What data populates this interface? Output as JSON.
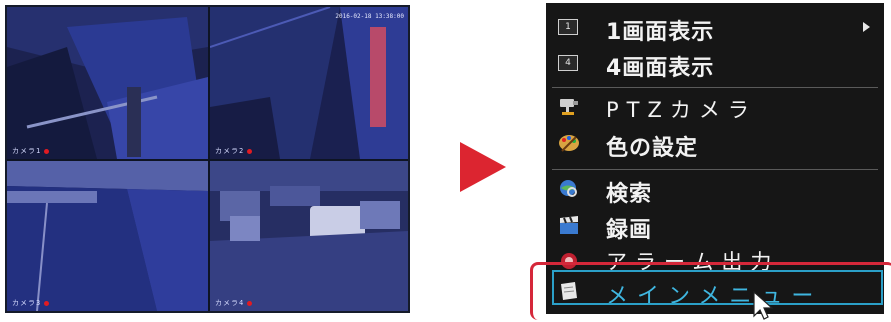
{
  "camera_view": {
    "timestamp": "2016-02-18 13:38:00",
    "tiles": [
      {
        "label": "カメラ1"
      },
      {
        "label": "カメラ2"
      },
      {
        "label": "カメラ3"
      },
      {
        "label": "カメラ4"
      }
    ]
  },
  "menu": {
    "items": [
      {
        "icon": "box-1-icon",
        "box_text": "1",
        "label": "1画面表示",
        "submenu": true
      },
      {
        "icon": "box-4-icon",
        "box_text": "4",
        "label": "4画面表示"
      },
      {
        "icon": "ptz-camera-icon",
        "label": "PTZカメラ"
      },
      {
        "icon": "palette-icon",
        "label": "色の設定"
      },
      {
        "icon": "search-globe-icon",
        "label": "検索"
      },
      {
        "icon": "clapperboard-icon",
        "label": "録画"
      },
      {
        "icon": "alarm-icon",
        "label": "アラーム出力"
      },
      {
        "icon": "document-icon",
        "label": "メインメニュー",
        "highlighted": true
      }
    ]
  },
  "colors": {
    "menu_background": "#161616",
    "highlight_text": "#3fb6e0",
    "highlight_border": "#2ba0c8",
    "callout_red": "#d5283a",
    "arrow_red": "#dc2530"
  }
}
